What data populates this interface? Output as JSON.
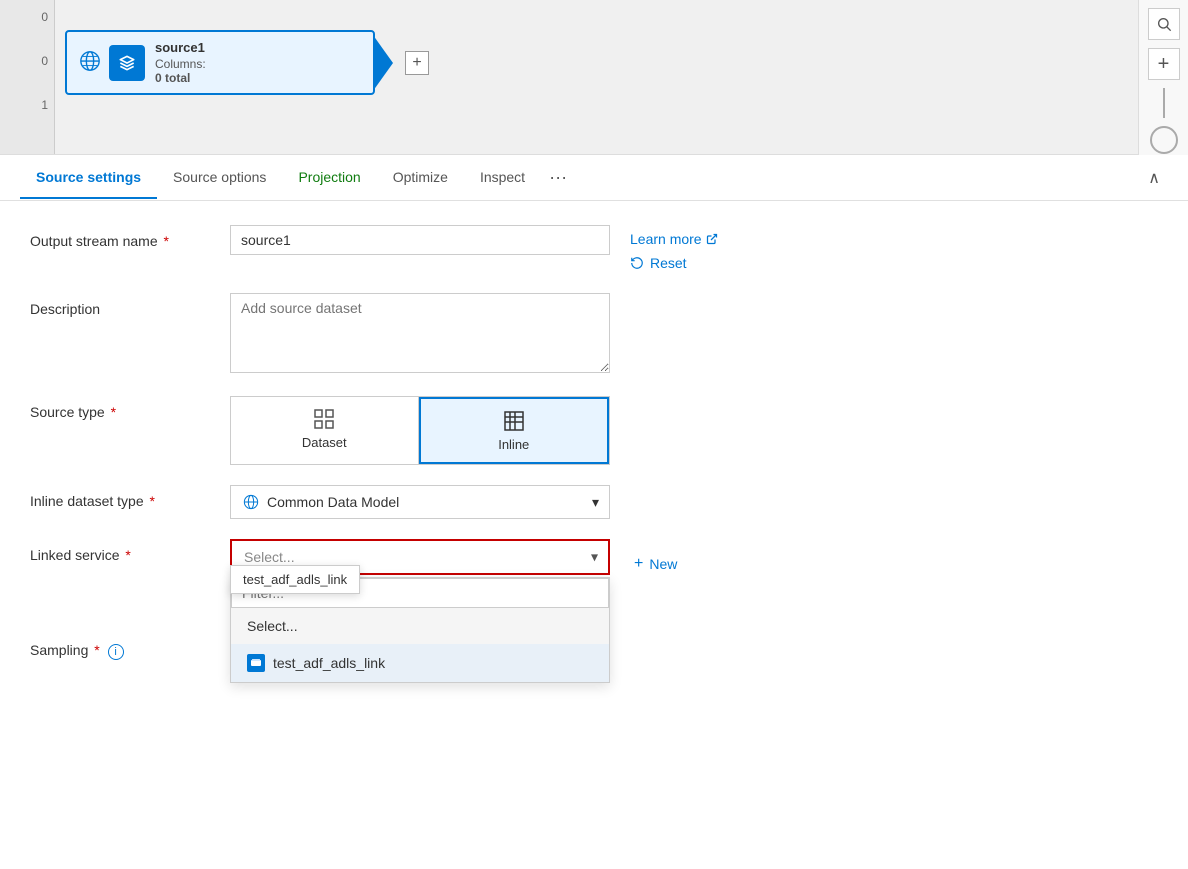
{
  "canvas": {
    "ruler_numbers": [
      "0",
      "0",
      "1"
    ],
    "node": {
      "name": "source1",
      "columns_label": "Columns:",
      "columns_value": "0 total"
    },
    "add_button_label": "+"
  },
  "tabs": {
    "items": [
      {
        "id": "source-settings",
        "label": "Source settings",
        "active": true,
        "color": "default"
      },
      {
        "id": "source-options",
        "label": "Source options",
        "active": false,
        "color": "default"
      },
      {
        "id": "projection",
        "label": "Projection",
        "active": false,
        "color": "green"
      },
      {
        "id": "optimize",
        "label": "Optimize",
        "active": false,
        "color": "default"
      },
      {
        "id": "inspect",
        "label": "Inspect",
        "active": false,
        "color": "default"
      }
    ],
    "dots_label": "···",
    "collapse_label": "∧"
  },
  "form": {
    "output_stream": {
      "label": "Output stream name",
      "required": true,
      "value": "source1",
      "placeholder": ""
    },
    "description": {
      "label": "Description",
      "required": false,
      "placeholder": "Add source dataset",
      "value": ""
    },
    "source_type": {
      "label": "Source type",
      "required": true,
      "options": [
        {
          "id": "dataset",
          "label": "Dataset",
          "active": false
        },
        {
          "id": "inline",
          "label": "Inline",
          "active": true
        }
      ]
    },
    "inline_dataset_type": {
      "label": "Inline dataset type",
      "required": true,
      "value": "Common Data Model",
      "placeholder": ""
    },
    "linked_service": {
      "label": "Linked service",
      "required": true,
      "placeholder": "Select...",
      "value": ""
    },
    "sampling": {
      "label": "Sampling",
      "required": true,
      "has_info": true
    },
    "learn_more_label": "Learn more",
    "reset_label": "Reset",
    "new_btn_label": "New",
    "dropdown": {
      "filter_placeholder": "Filter...",
      "option_default": "Select...",
      "option_item": "test_adf_adls_link"
    },
    "tooltip": {
      "text": "test_adf_adls_link"
    }
  }
}
